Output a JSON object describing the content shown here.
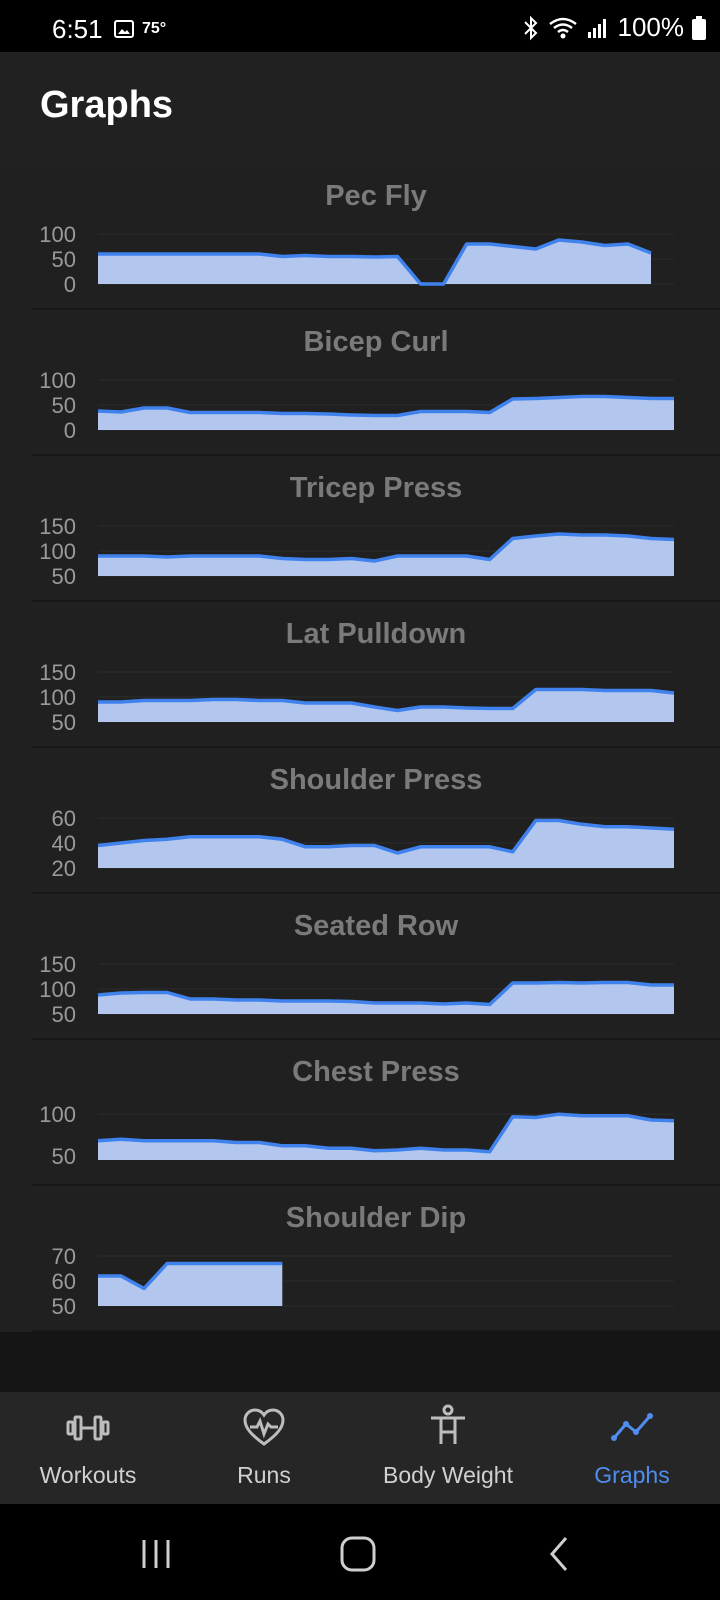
{
  "status_bar": {
    "time": "6:51",
    "temperature": "75°",
    "battery": "100%"
  },
  "app_bar": {
    "title": "Graphs"
  },
  "charts_style": {
    "fill": "#b3c7ee",
    "stroke": "#3f82ee",
    "grid": "#2c2c2c",
    "axis_text": "#9a9a9a"
  },
  "chart_data": [
    {
      "type": "area",
      "title": "Pec Fly",
      "yticks": [
        "100",
        "50",
        "0"
      ],
      "ylim": [
        0,
        100
      ],
      "values": [
        60,
        60,
        60,
        60,
        60,
        60,
        60,
        60,
        55,
        57,
        55,
        55,
        54,
        55,
        0,
        0,
        80,
        80,
        75,
        70,
        88,
        84,
        77,
        80,
        62
      ]
    },
    {
      "type": "area",
      "title": "Bicep Curl",
      "yticks": [
        "100",
        "50",
        "0"
      ],
      "ylim": [
        0,
        100
      ],
      "values": [
        38,
        36,
        44,
        44,
        35,
        35,
        35,
        35,
        33,
        33,
        32,
        30,
        29,
        29,
        37,
        37,
        37,
        35,
        62,
        63,
        65,
        67,
        67,
        65,
        63,
        63
      ]
    },
    {
      "type": "area",
      "title": "Tricep Press",
      "yticks": [
        "150",
        "100",
        "50"
      ],
      "ylim": [
        50,
        150
      ],
      "values": [
        90,
        90,
        90,
        88,
        90,
        90,
        90,
        90,
        85,
        83,
        83,
        85,
        80,
        90,
        90,
        90,
        90,
        83,
        125,
        130,
        134,
        132,
        132,
        130,
        125,
        123
      ]
    },
    {
      "type": "area",
      "title": "Lat Pulldown",
      "yticks": [
        "150",
        "100",
        "50"
      ],
      "ylim": [
        50,
        150
      ],
      "values": [
        90,
        90,
        93,
        93,
        93,
        95,
        95,
        93,
        93,
        88,
        88,
        88,
        80,
        73,
        80,
        80,
        78,
        77,
        77,
        115,
        115,
        115,
        113,
        113,
        113,
        108
      ]
    },
    {
      "type": "area",
      "title": "Shoulder Press",
      "yticks": [
        "60",
        "40",
        "20"
      ],
      "ylim": [
        20,
        60
      ],
      "values": [
        38,
        40,
        42,
        43,
        45,
        45,
        45,
        45,
        43,
        37,
        37,
        38,
        38,
        32,
        37,
        37,
        37,
        37,
        33,
        58,
        58,
        55,
        53,
        53,
        52,
        51
      ]
    },
    {
      "type": "area",
      "title": "Seated Row",
      "yticks": [
        "150",
        "100",
        "50"
      ],
      "ylim": [
        50,
        150
      ],
      "values": [
        88,
        92,
        93,
        93,
        80,
        80,
        78,
        78,
        76,
        76,
        76,
        75,
        72,
        72,
        72,
        70,
        72,
        69,
        112,
        112,
        113,
        112,
        113,
        113,
        108,
        108
      ]
    },
    {
      "type": "area",
      "title": "Chest Press",
      "yticks": [
        "100",
        "50"
      ],
      "ylim": [
        45,
        105
      ],
      "values": [
        68,
        70,
        68,
        68,
        68,
        68,
        66,
        66,
        62,
        62,
        59,
        59,
        56,
        57,
        59,
        57,
        57,
        55,
        97,
        96,
        100,
        98,
        98,
        98,
        93,
        92
      ]
    },
    {
      "type": "area",
      "title": "Shoulder Dip",
      "yticks": [
        "70",
        "60",
        "50"
      ],
      "ylim": [
        50,
        70
      ],
      "values": [
        62,
        62,
        57,
        67,
        67,
        67,
        67,
        67,
        67
      ]
    }
  ],
  "bottom_nav": [
    {
      "label": "Workouts",
      "icon": "dumbbell-icon",
      "active": false
    },
    {
      "label": "Runs",
      "icon": "heart-pulse-icon",
      "active": false
    },
    {
      "label": "Body Weight",
      "icon": "person-icon",
      "active": false
    },
    {
      "label": "Graphs",
      "icon": "line-graph-icon",
      "active": true
    }
  ]
}
